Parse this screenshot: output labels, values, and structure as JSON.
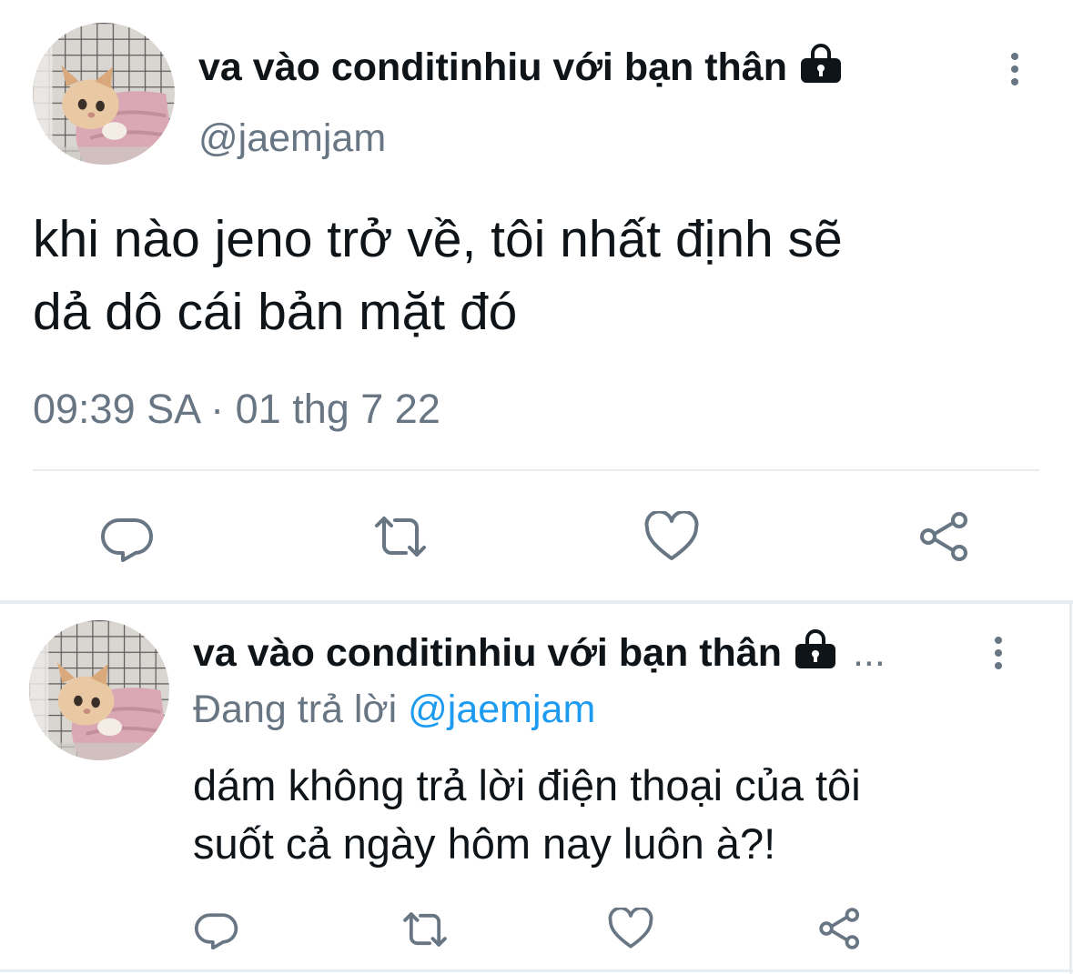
{
  "main_tweet": {
    "display_name": "va vào conditinhiu với bạn thân",
    "handle": "@jaemjam",
    "text_line1": "khi nào jeno trở về, tôi nhất định sẽ",
    "text_line2": "dả dô cái bản mặt đó",
    "timestamp": "09:39 SA · 01 thg 7 22"
  },
  "reply_tweet": {
    "display_name": "va vào conditinhiu với bạn thân",
    "ellipsis": "...",
    "replying_prefix": "Đang trả lời",
    "replying_handle": "@jaemjam",
    "text_line1": "dám không trả lời điện thoại của tôi",
    "text_line2": "suốt cả ngày hôm nay luôn à?!"
  },
  "icons": {
    "protected": "lock-icon",
    "menu": "more-vertical-icon",
    "reply": "reply-icon",
    "retweet": "retweet-icon",
    "like": "heart-icon",
    "share": "share-icon"
  },
  "colors": {
    "text": "#0f1419",
    "muted": "#687684",
    "link": "#1d9bf0",
    "divider": "#e6ecf0"
  }
}
